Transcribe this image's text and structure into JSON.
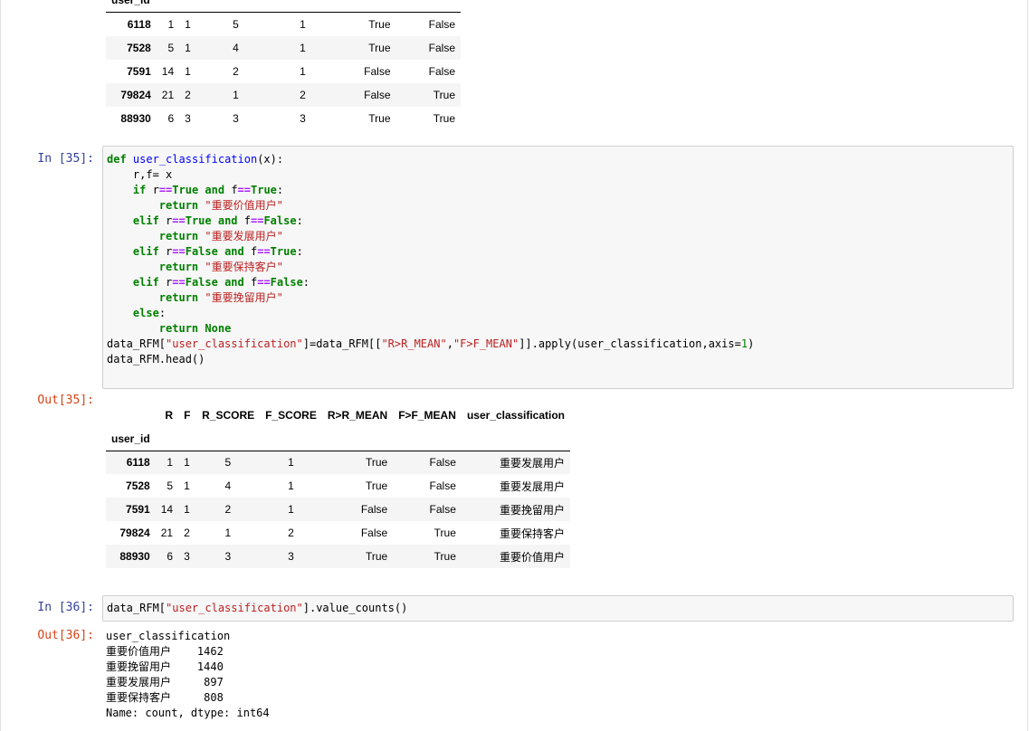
{
  "table1": {
    "partial_header": "user_id",
    "rows": [
      [
        "6118",
        "1",
        "1",
        "5",
        "1",
        "True",
        "False"
      ],
      [
        "7528",
        "5",
        "1",
        "4",
        "1",
        "True",
        "False"
      ],
      [
        "7591",
        "14",
        "1",
        "2",
        "1",
        "False",
        "False"
      ],
      [
        "79824",
        "21",
        "2",
        "1",
        "2",
        "False",
        "True"
      ],
      [
        "88930",
        "6",
        "3",
        "3",
        "3",
        "True",
        "True"
      ]
    ]
  },
  "cell35": {
    "in_prompt": "In  [35]:",
    "out_prompt": "Out[35]:",
    "code_lines": {
      "l1_def": "def",
      "l1_fn": "user_classification",
      "l1_rest": "(x):",
      "l2": "    r,f= x",
      "s1": "\"重要价值用户\"",
      "s2": "\"重要发展用户\"",
      "s3": "\"重要保持客户\"",
      "s4": "\"重要挽留用户\"",
      "l12_a": "data_RFM[",
      "l12_s1": "\"user_classification\"",
      "l12_b": "]=data_RFM[[",
      "l12_s2": "\"R>R_MEAN\"",
      "l12_c": ",",
      "l12_s3": "\"F>F_MEAN\"",
      "l12_d": "]].apply(user_classification,axis=",
      "l12_n": "1",
      "l12_e": ")",
      "l13": "data_RFM.head()"
    }
  },
  "table2": {
    "columns": [
      "R",
      "F",
      "R_SCORE",
      "F_SCORE",
      "R>R_MEAN",
      "F>F_MEAN",
      "user_classification"
    ],
    "index_name": "user_id",
    "rows": [
      [
        "6118",
        "1",
        "1",
        "5",
        "1",
        "True",
        "False",
        "重要发展用户"
      ],
      [
        "7528",
        "5",
        "1",
        "4",
        "1",
        "True",
        "False",
        "重要发展用户"
      ],
      [
        "7591",
        "14",
        "1",
        "2",
        "1",
        "False",
        "False",
        "重要挽留用户"
      ],
      [
        "79824",
        "21",
        "2",
        "1",
        "2",
        "False",
        "True",
        "重要保持客户"
      ],
      [
        "88930",
        "6",
        "3",
        "3",
        "3",
        "True",
        "True",
        "重要价值用户"
      ]
    ]
  },
  "cell36": {
    "in_prompt": "In  [36]:",
    "out_prompt": "Out[36]:",
    "code_a": "data_RFM[",
    "code_s": "\"user_classification\"",
    "code_b": "].value_counts()",
    "output_lines": [
      "user_classification",
      "重要价值用户    1462",
      "重要挽留用户    1440",
      "重要发展用户     897",
      "重要保持客户     808",
      "Name: count, dtype: int64"
    ]
  }
}
